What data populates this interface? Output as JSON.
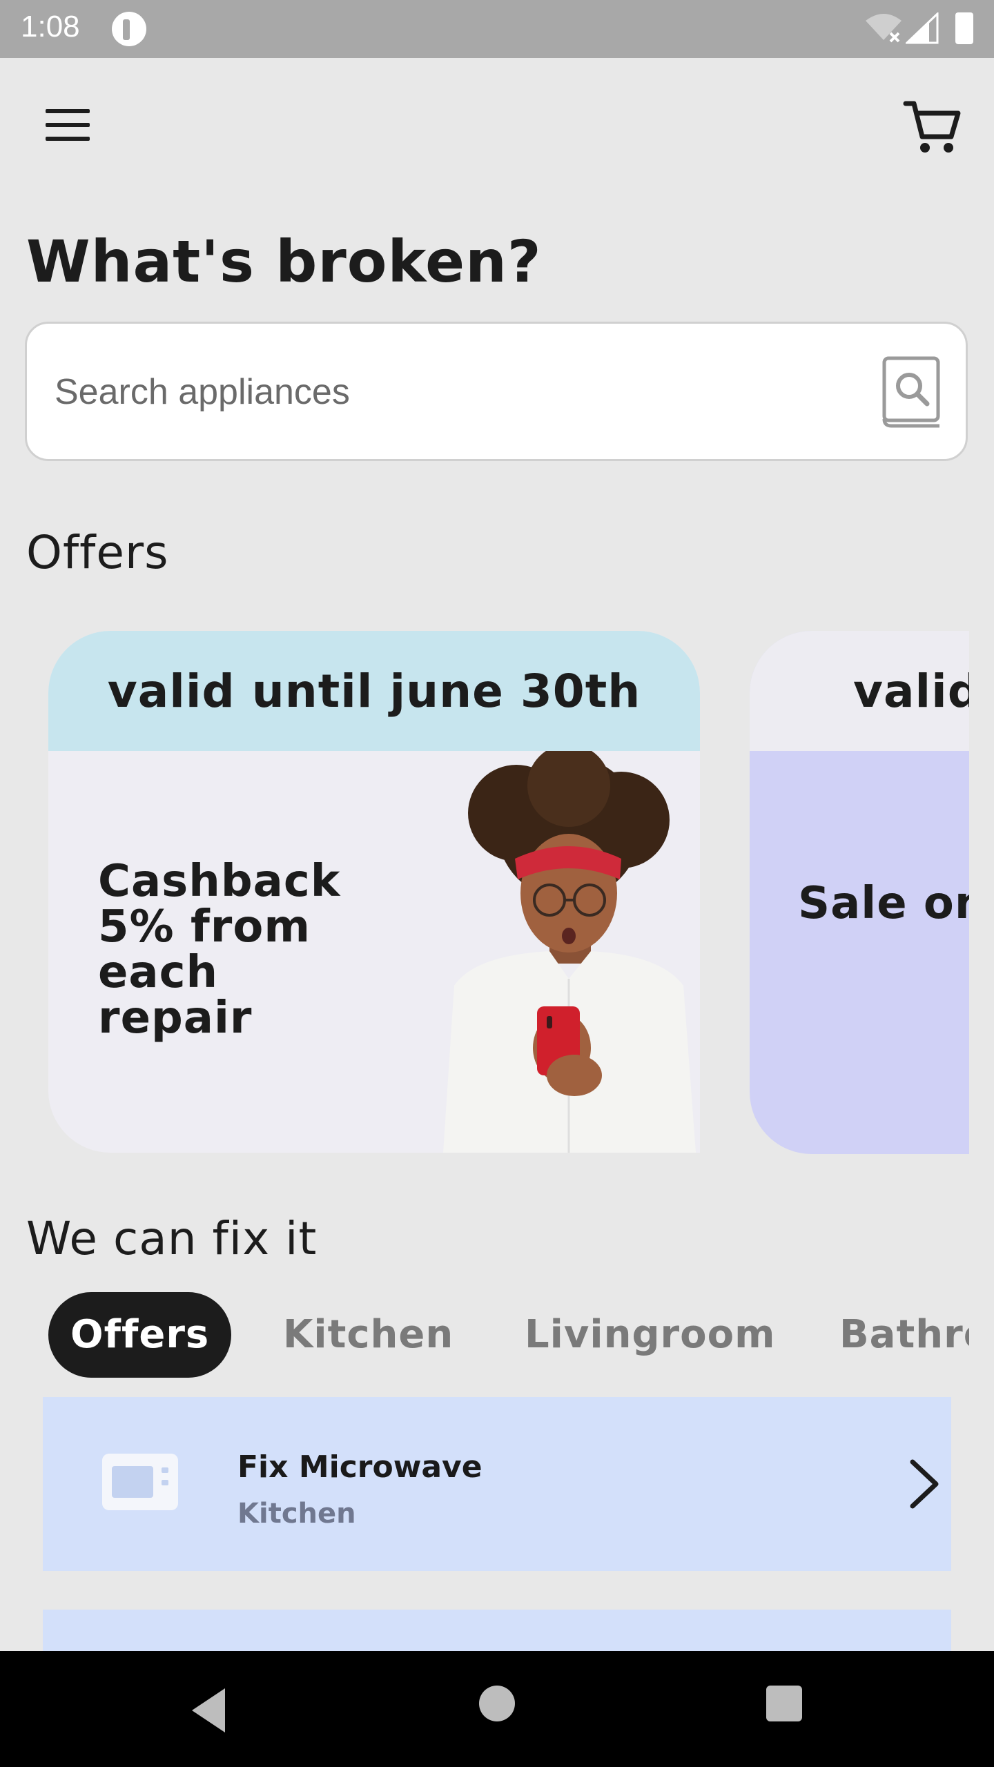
{
  "status_bar": {
    "time": "1:08"
  },
  "header": {
    "title": "What's broken?"
  },
  "search": {
    "placeholder": "Search appliances"
  },
  "offers": {
    "title": "Offers",
    "cards": [
      {
        "validity": "valid until june 30th",
        "text": "Cashback 5% from each repair",
        "color": "#c7e5ee"
      },
      {
        "validity": "valid",
        "text": "Sale on applian repair!",
        "color": "#d0d1f6"
      }
    ]
  },
  "fix": {
    "title": "We can fix it",
    "tabs": [
      "Offers",
      "Kitchen",
      "Livingroom",
      "Bathro"
    ],
    "active_tab": "Offers"
  },
  "repairs": [
    {
      "title": "Fix Microwave",
      "category": "Kitchen",
      "icon": "microwave-icon"
    }
  ],
  "colors": {
    "accent_dark": "#1c1c1c",
    "list_item": "#d3e0fa"
  }
}
